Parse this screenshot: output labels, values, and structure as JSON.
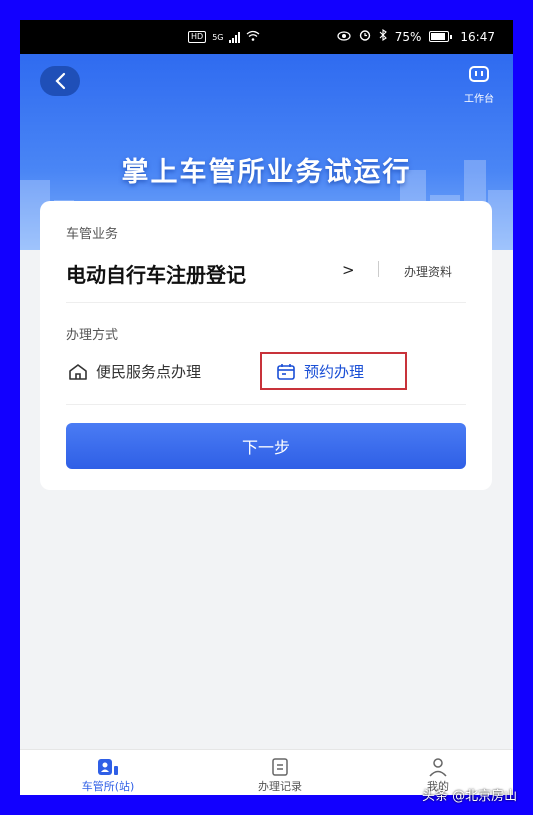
{
  "status_bar": {
    "hd": "HD",
    "network": "5G",
    "battery": "75%",
    "time": "16:47"
  },
  "header": {
    "back_icon": "chevron-left-icon",
    "workbench_label": "工作台",
    "banner_title": "掌上车管所业务试运行"
  },
  "card": {
    "section_business_label": "车管业务",
    "service_name": "电动自行车注册登记",
    "chevron": ">",
    "materials_link": "办理资料",
    "section_method_label": "办理方式",
    "methods": [
      {
        "label": "便民服务点办理",
        "icon": "home-icon"
      },
      {
        "label": "预约办理",
        "icon": "calendar-icon"
      }
    ],
    "next_button": "下一步"
  },
  "tabbar": {
    "items": [
      {
        "label": "车管所(站)",
        "icon": "station-icon",
        "active": true
      },
      {
        "label": "办理记录",
        "icon": "record-icon",
        "active": false
      },
      {
        "label": "我的",
        "icon": "user-icon",
        "active": false
      }
    ]
  },
  "watermark": "头条 @北京房山",
  "colors": {
    "frame": "#1200ff",
    "primary": "#2f5fe6",
    "highlight_border": "#c8323a"
  }
}
